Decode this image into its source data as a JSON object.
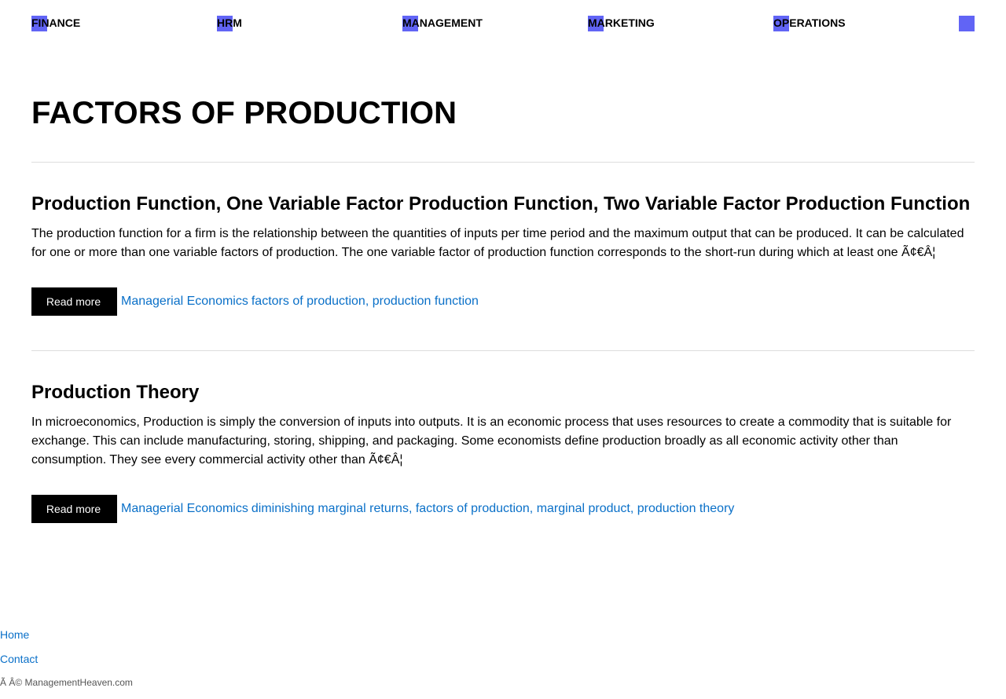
{
  "colors": {
    "accent": "#6164f5",
    "link": "#0a70c8",
    "button_bg": "#000000",
    "divider": "#dddddd"
  },
  "nav": {
    "items": [
      {
        "label": "FINANCE",
        "icon": "square-icon"
      },
      {
        "label": "HRM",
        "icon": "square-icon"
      },
      {
        "label": "MANAGEMENT",
        "icon": "square-icon"
      },
      {
        "label": "MARKETING",
        "icon": "square-icon"
      },
      {
        "label": "OPERATIONS",
        "icon": "square-icon"
      },
      {
        "label": "",
        "icon": "square-icon"
      }
    ]
  },
  "page": {
    "title": "FACTORS OF PRODUCTION"
  },
  "posts": [
    {
      "title": "Production Function, One Variable Factor Production Function, Two Variable Factor Production Function",
      "excerpt": "The production function for a firm is the relationship between the quantities of inputs per time period and the maximum output that can be produced. It can be calculated for one or more than one variable factors of production. The one variable factor of production function corresponds to the short-run during which at least one Ã¢€Â¦",
      "read_more": "Read more",
      "category": "Managerial Economics",
      "tags": "factors of production, production function"
    },
    {
      "title": "Production Theory",
      "excerpt": "In microeconomics, Production is simply the conversion of inputs into outputs. It is an economic process that uses resources to create a commodity that is suitable for exchange. This can include manufacturing, storing, shipping, and packaging. Some economists define production broadly as all economic activity other than consumption. They see every commercial activity other than Ã¢€Â¦",
      "read_more": "Read more",
      "category": "Managerial Economics",
      "tags": "diminishing marginal returns, factors of production, marginal product, production theory"
    }
  ],
  "footer": {
    "links": [
      "Home",
      "Contact"
    ],
    "copyright": "Ã   Â© ManagementHeaven.com"
  }
}
